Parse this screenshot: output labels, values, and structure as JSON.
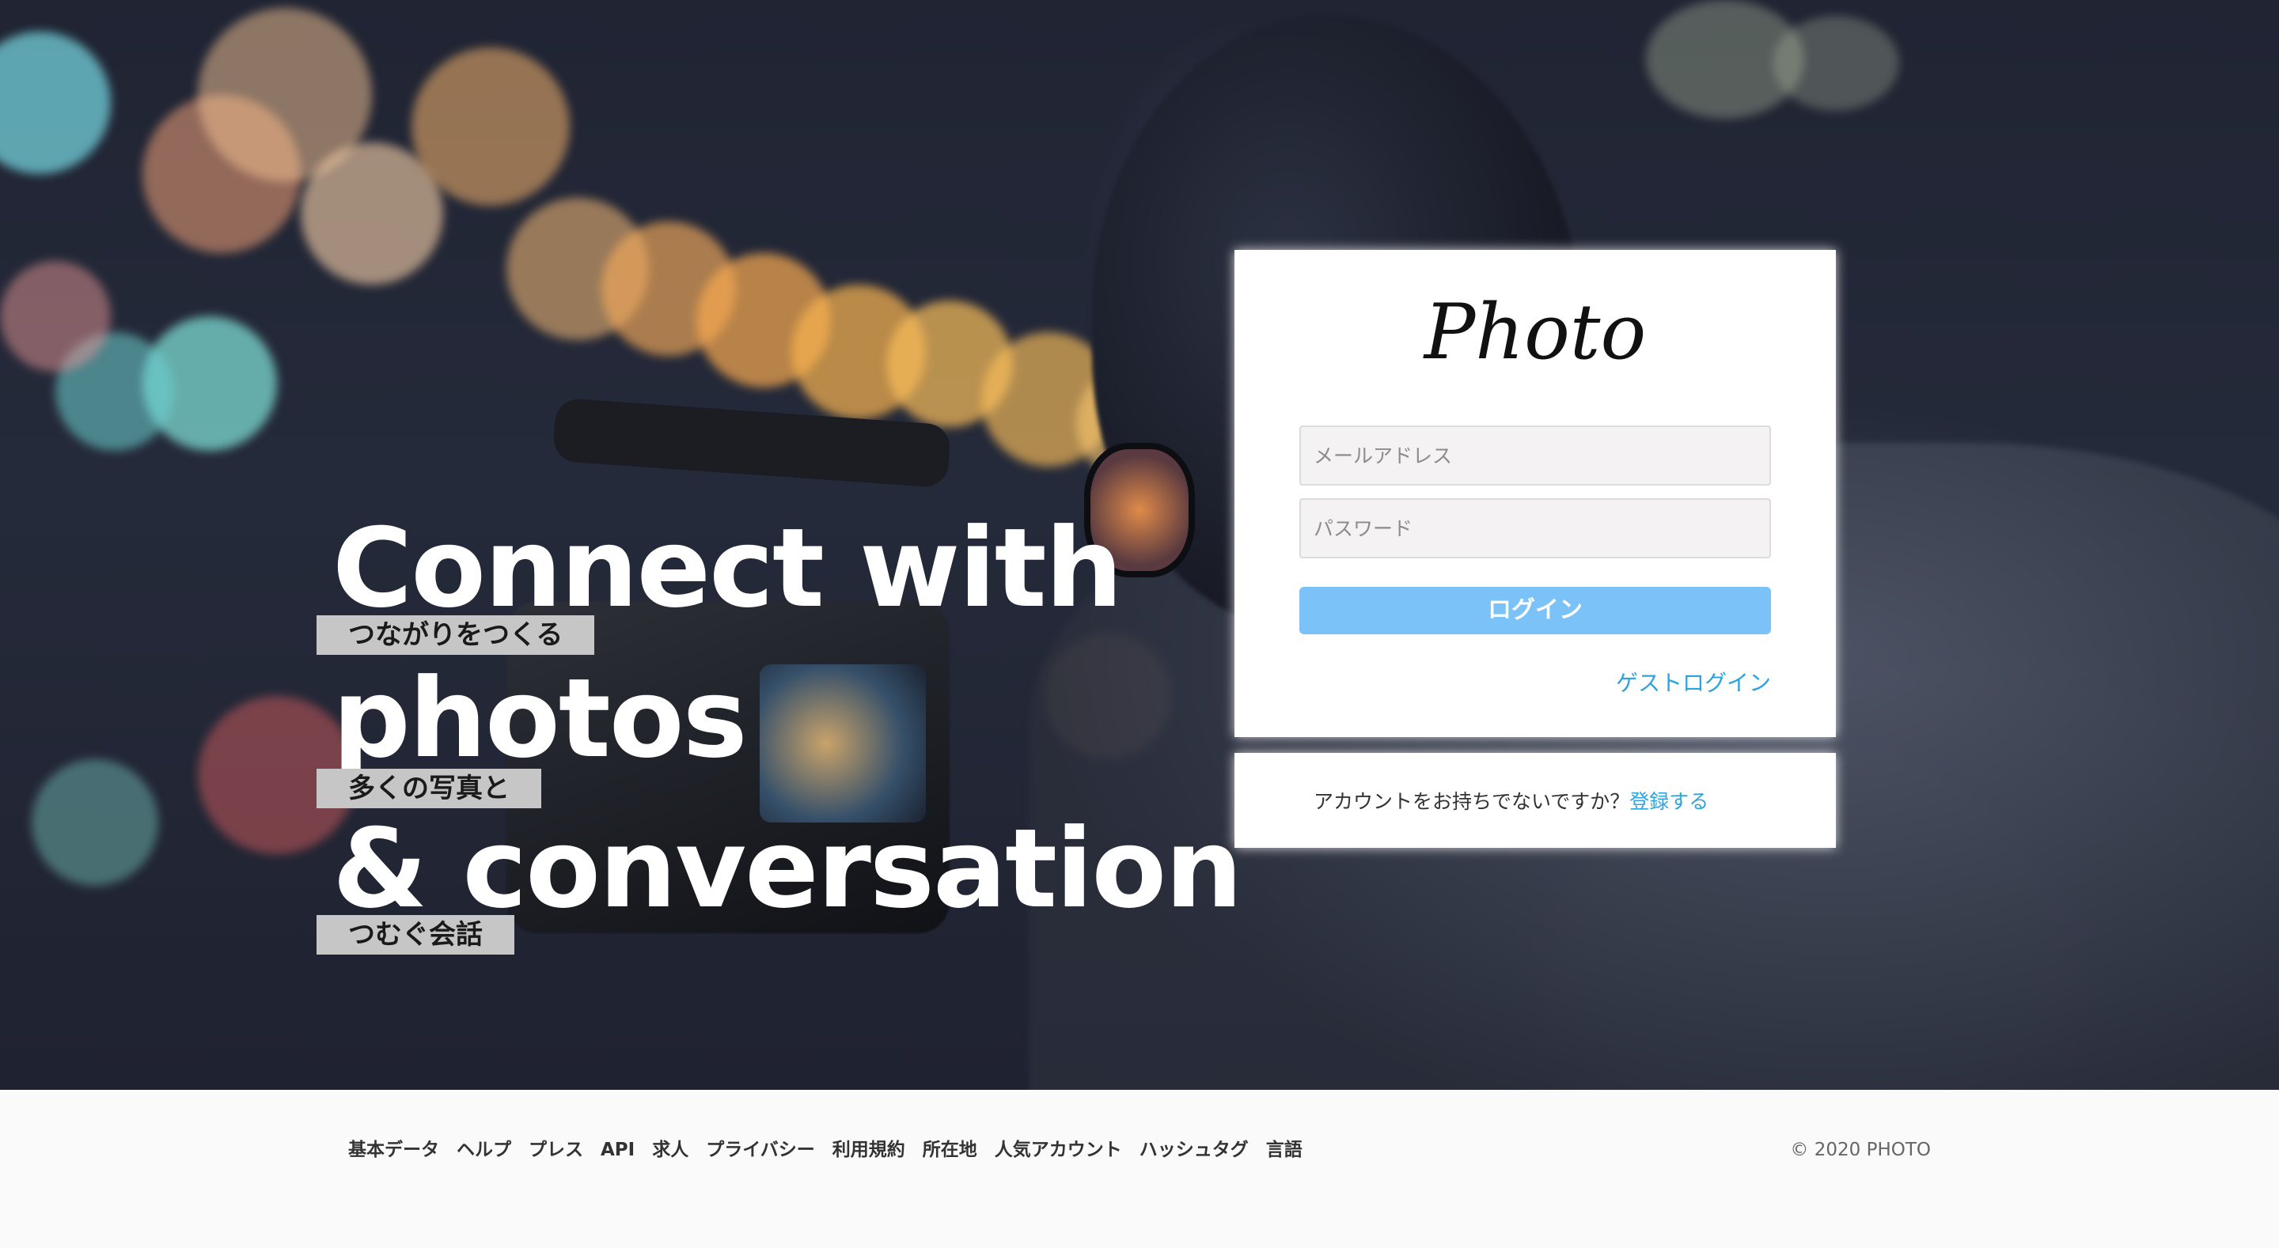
{
  "hero": {
    "headline_lines": [
      "Connect with",
      "photos",
      "& conversation"
    ],
    "subtitles": [
      "つながりをつくる",
      "多くの写真と",
      "つむぐ会話"
    ]
  },
  "login": {
    "logo": "Photo",
    "email_placeholder": "メールアドレス",
    "password_placeholder": "パスワード",
    "login_button": "ログイン",
    "guest_login": "ゲストログイン"
  },
  "signup": {
    "prompt": "アカウントをお持ちでないですか？",
    "link": "登録する"
  },
  "footer": {
    "links": [
      "基本データ",
      "ヘルプ",
      "プレス",
      "API",
      "求人",
      "プライバシー",
      "利用規約",
      "所在地",
      "人気アカウント",
      "ハッシュタグ",
      "言語"
    ],
    "copyright": "© 2020 PHOTO"
  },
  "colors": {
    "accent": "#2ba4e0",
    "login_button": "#7ac2f7",
    "footer_bg": "#fafafa"
  }
}
